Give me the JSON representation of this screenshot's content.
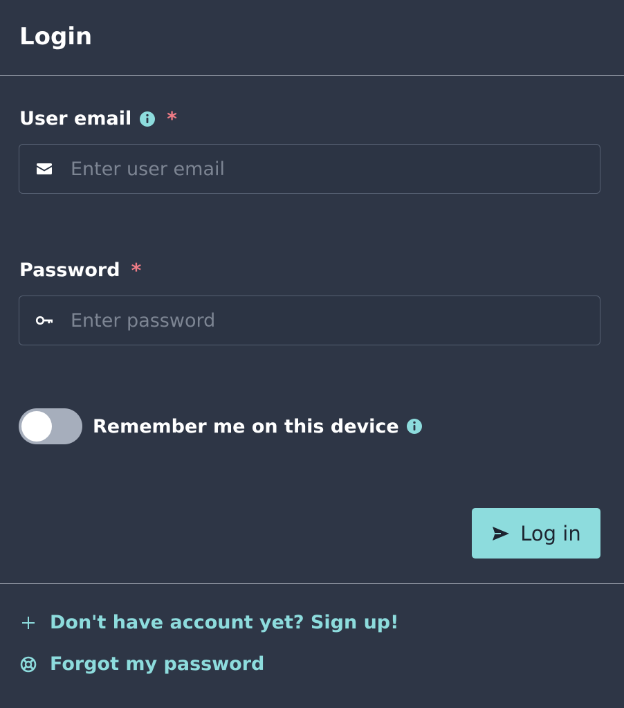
{
  "header": {
    "title": "Login"
  },
  "email_field": {
    "label": "User email",
    "required_mark": "*",
    "placeholder": "Enter user email",
    "value": "",
    "icon": "envelope-icon"
  },
  "password_field": {
    "label": "Password",
    "required_mark": "*",
    "placeholder": "Enter password",
    "value": "",
    "icon": "key-icon"
  },
  "remember_me": {
    "label": "Remember me on this device",
    "checked": false
  },
  "actions": {
    "login_label": "Log in",
    "login_icon": "send-icon"
  },
  "footer": {
    "signup_label": "Don't have account yet? Sign up!",
    "signup_icon": "plus-icon",
    "forgot_label": "Forgot my password",
    "forgot_icon": "lifebuoy-icon"
  },
  "colors": {
    "background": "#2e3646",
    "accent": "#8ddcdd",
    "required": "#ef7c86",
    "toggle_off": "#a6aebc",
    "input_border": "#566072",
    "divider": "#b6bcc7"
  }
}
